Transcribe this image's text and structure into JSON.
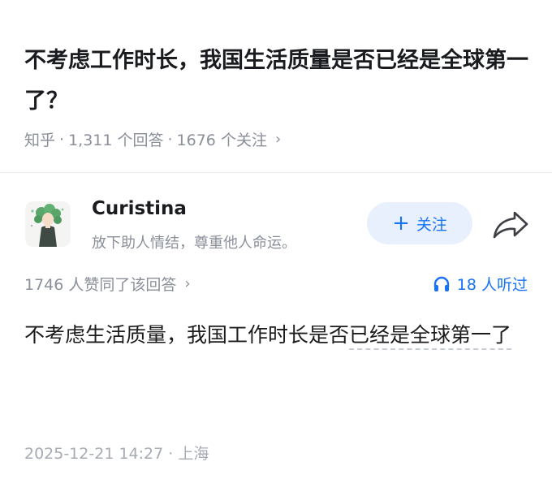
{
  "question": {
    "title": "不考虑工作时长，我国生活质量是否已经是全球第一了？",
    "source": "知乎",
    "answer_count": "1,311 个回答",
    "follower_count": "1676 个关注",
    "chevron": "›"
  },
  "author": {
    "name": "Curistina",
    "bio": "放下助人情结，尊重他人命运。",
    "follow_label": "关注",
    "follow_plus": "+",
    "avatar_icon": "anime-character-avatar",
    "share_icon": "share-arrow-icon"
  },
  "stats": {
    "likes": "1746 人赞同了该回答",
    "listen": "18 人听过",
    "listen_icon": "headphones-icon"
  },
  "answer": {
    "text_main": "不考虑生活质量，我国工作时长是否",
    "text_link": "已经是全球第一了"
  },
  "footer": {
    "date": "2025-12-21 14:27",
    "separator": " · ",
    "location": "上海"
  },
  "colors": {
    "accent": "#1772f6",
    "meta_gray": "#8a8f99",
    "follow_bg": "#e8f0fd"
  }
}
